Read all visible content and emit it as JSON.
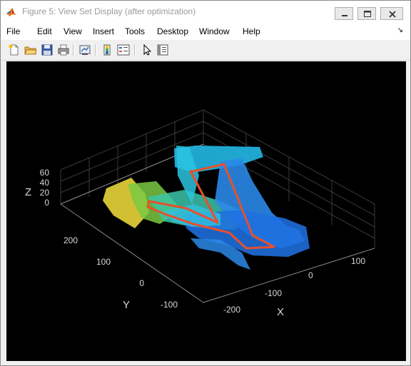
{
  "window": {
    "title": "Figure 5: View Set Display (after optimization)"
  },
  "menubar": {
    "items": [
      "File",
      "Edit",
      "View",
      "Insert",
      "Tools",
      "Desktop",
      "Window",
      "Help"
    ]
  },
  "toolbar": {
    "icons": [
      "new-figure-icon",
      "open-file-icon",
      "save-icon",
      "print-icon",
      "link-plot-icon",
      "insert-colorbar-icon",
      "insert-legend-icon",
      "pointer-icon",
      "property-inspector-icon"
    ]
  },
  "plot": {
    "z_label": "Z",
    "y_label": "Y",
    "x_label": "X",
    "z_ticks": [
      "60",
      "40",
      "20",
      "0"
    ],
    "y_ticks": [
      "200",
      "100",
      "0",
      "-100"
    ],
    "x_ticks": [
      "100",
      "0",
      "-100",
      "-200"
    ]
  },
  "colors": {
    "trajectory": "#e8502a",
    "background": "#000000",
    "grid": "#3a3a3a"
  }
}
